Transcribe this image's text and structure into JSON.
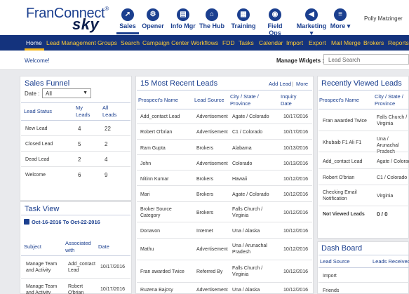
{
  "brand": {
    "name": "FranConnect",
    "tm": "®",
    "sub": "sky"
  },
  "modules": [
    {
      "label": "Sales",
      "icon": "rocket-icon"
    },
    {
      "label": "Opener",
      "icon": "gear-icon"
    },
    {
      "label": "Info Mgr",
      "icon": "id-card-icon"
    },
    {
      "label": "The Hub",
      "icon": "hub-icon"
    },
    {
      "label": "Training",
      "icon": "board-icon"
    },
    {
      "label": "Field Ops",
      "icon": "car-icon"
    },
    {
      "label": "Marketing ▾",
      "icon": "megaphone-icon"
    },
    {
      "label": "More ▾",
      "icon": "menu-icon"
    }
  ],
  "user": "Polly Matzinger",
  "nav": [
    "Home",
    "Lead Management",
    "Groups",
    "Search",
    "Campaign Center",
    "Workflows",
    "FDD",
    "Tasks",
    "Calendar",
    "Import",
    "Export",
    "Mail Merge",
    "Brokers",
    "Reports"
  ],
  "welcome": "Welcome!",
  "manage_widgets": "Manage Widgets :",
  "lead_search_placeholder": "Lead Search",
  "funnel": {
    "title": "Sales Funnel",
    "date_label": "Date :",
    "date_value": "All",
    "headers": [
      "Lead Status",
      "My Leads",
      "All Leads"
    ],
    "rows": [
      {
        "status": "New Lead",
        "my": "4",
        "all": "22"
      },
      {
        "status": "Closed Lead",
        "my": "5",
        "all": "2"
      },
      {
        "status": "Dead Lead",
        "my": "2",
        "all": "4"
      },
      {
        "status": "Welcome",
        "my": "6",
        "all": "9"
      }
    ]
  },
  "task": {
    "title": "Task View",
    "range": "Oct-16-2016 To Oct-22-2016",
    "headers": [
      "Subject",
      "Associated with",
      "Date"
    ],
    "rows": [
      {
        "subject": "Manage Team and Activity",
        "with": "Add_contact Lead",
        "date": "10/17/2016"
      },
      {
        "subject": "Manage Team and Activity",
        "with": "Robert O'brian",
        "date": "10/17/2016"
      }
    ]
  },
  "recent": {
    "title": "15 Most Recent Leads",
    "add": "Add Lead",
    "sep": "|",
    "more": "More",
    "headers": [
      "Prospect's Name",
      "Lead Source",
      "City / State / Province",
      "Inquiry Date"
    ],
    "rows": [
      {
        "name": "Add_contact Lead",
        "source": "Advertisement",
        "city": "Agate / Colorado",
        "date": "10/17/2016"
      },
      {
        "name": "Robert O'brian",
        "source": "Advertisement",
        "city": "C1 / Colorado",
        "date": "10/17/2016"
      },
      {
        "name": "Ram Gupta",
        "source": "Brokers",
        "city": "Alabama",
        "date": "10/13/2016"
      },
      {
        "name": "John",
        "source": "Advertisement",
        "city": "Colorado",
        "date": "10/13/2016"
      },
      {
        "name": "Nitinn Kumar",
        "source": "Brokers",
        "city": "Hawaii",
        "date": "10/12/2016"
      },
      {
        "name": "Mari",
        "source": "Brokers",
        "city": "Agate / Colorado",
        "date": "10/12/2016"
      },
      {
        "name": "Broker Source Category",
        "source": "Brokers",
        "city": "Falls Church / Virginia",
        "date": "10/12/2016"
      },
      {
        "name": "Donavon",
        "source": "Internet",
        "city": "Una / Alaska",
        "date": "10/12/2016"
      },
      {
        "name": "Mathu",
        "source": "Advertisement",
        "city": "Una / Arunachal Pradesh",
        "date": "10/12/2016"
      },
      {
        "name": "Fran awarded Twice",
        "source": "Referred By",
        "city": "Falls Church / Virginia",
        "date": "10/12/2016"
      },
      {
        "name": "Ruzena Bajcsy",
        "source": "Advertisement",
        "city": "Una / Alaska",
        "date": "10/12/2016"
      }
    ]
  },
  "viewed": {
    "title": "Recently Viewed Leads",
    "headers": [
      "Prospect's Name",
      "City / State / Province"
    ],
    "rows": [
      {
        "name": "Fran awarded Twice",
        "city": "Falls Church / Virginia"
      },
      {
        "name": "Khubaib F1 Ali F1",
        "city": "Una / Arunachal Pradesh"
      },
      {
        "name": "Add_contact Lead",
        "city": "Agate / Colorado"
      },
      {
        "name": "Robert O'brian",
        "city": "C1 / Colorado"
      },
      {
        "name": "Checking Email Notification",
        "city": "Virginia"
      }
    ],
    "not_viewed_label": "Not Viewed Leads",
    "not_viewed_value": "0 / 0"
  },
  "dash": {
    "title": "Dash Board",
    "headers": [
      "Lead Source",
      "Leads Received"
    ],
    "rows": [
      {
        "source": "Import"
      },
      {
        "source": "Friends"
      }
    ]
  },
  "colors": {
    "brand": "#1b3f8f",
    "nav_bg": "#14337d",
    "nav_text": "#ffcc33"
  }
}
